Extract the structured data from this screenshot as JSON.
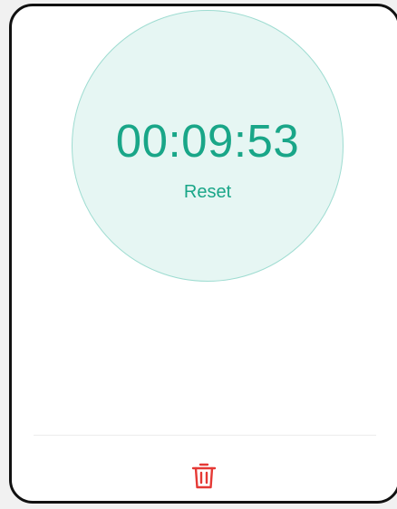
{
  "stopwatch": {
    "time": "00:09:53",
    "reset_label": "Reset"
  },
  "footer": {
    "delete_icon": "trash-icon"
  },
  "colors": {
    "accent": "#19a688",
    "dial_fill": "#e6f6f3",
    "dial_border": "#9edcd1",
    "delete": "#e53935"
  }
}
